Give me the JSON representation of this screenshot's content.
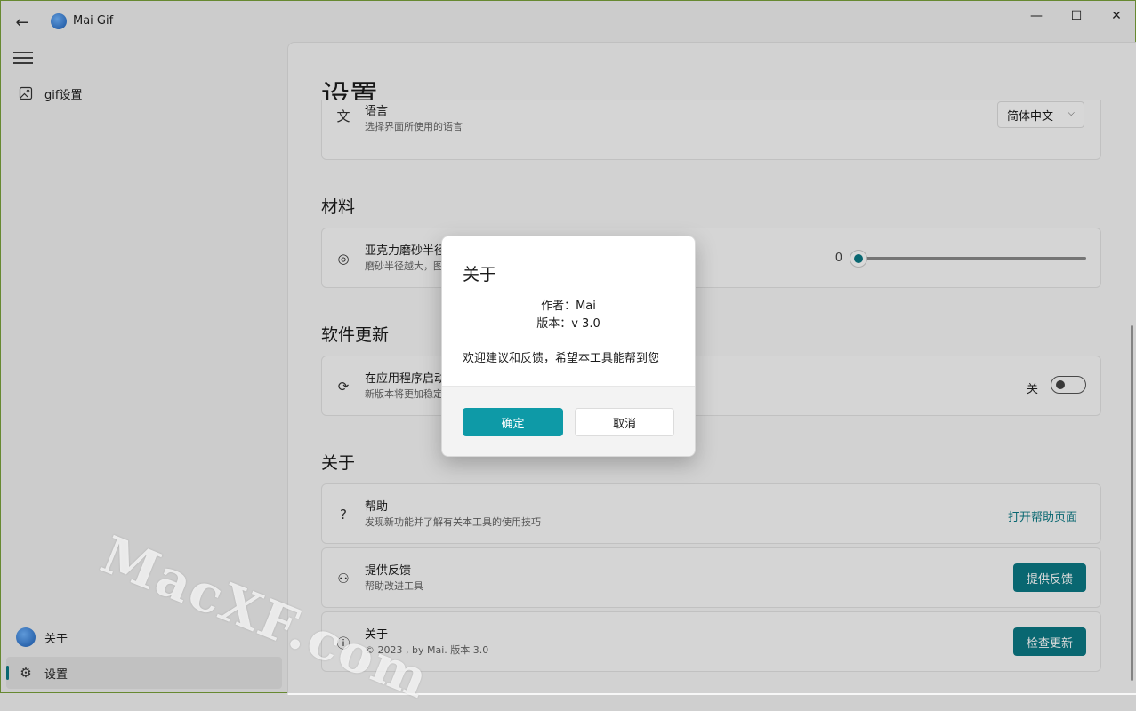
{
  "app": {
    "title": "Mai Gif"
  },
  "window_controls": {
    "minimize": "—",
    "maximize": "☐",
    "close": "✕"
  },
  "nav": {
    "items": [
      {
        "label": "gif设置"
      }
    ],
    "footer": [
      {
        "label": "关于"
      },
      {
        "label": "设置"
      }
    ]
  },
  "page": {
    "title": "设置",
    "language": {
      "title": "语言",
      "desc": "选择界面所使用的语言",
      "value": "简体中文"
    },
    "material_section": "材料",
    "acrylic": {
      "title": "亚克力磨砂半径",
      "desc": "磨砂半径越大，图",
      "value": "0",
      "fraction": 0
    },
    "update_section": "软件更新",
    "auto_update": {
      "title": "在应用程序启动",
      "desc": "新版本将更加稳定",
      "toggle_label": "关"
    },
    "about_section": "关于",
    "help": {
      "title": "帮助",
      "desc": "发现新功能并了解有关本工具的使用技巧",
      "action": "打开帮助页面"
    },
    "feedback": {
      "title": "提供反馈",
      "desc": "帮助改进工具",
      "action": "提供反馈"
    },
    "about": {
      "title": "关于",
      "desc": "©  2023 , by Mai. 版本  3.0",
      "action": "检查更新"
    }
  },
  "dialog": {
    "title": "关于",
    "author": "作者：Mai",
    "version": "版本：v 3.0",
    "message": "欢迎建议和反馈，希望本工具能帮到您",
    "ok": "确定",
    "cancel": "取消"
  },
  "watermark": "MacXF.com",
  "colors": {
    "accent": "#0b7a85",
    "dialog_primary": "#0e9aa7"
  }
}
